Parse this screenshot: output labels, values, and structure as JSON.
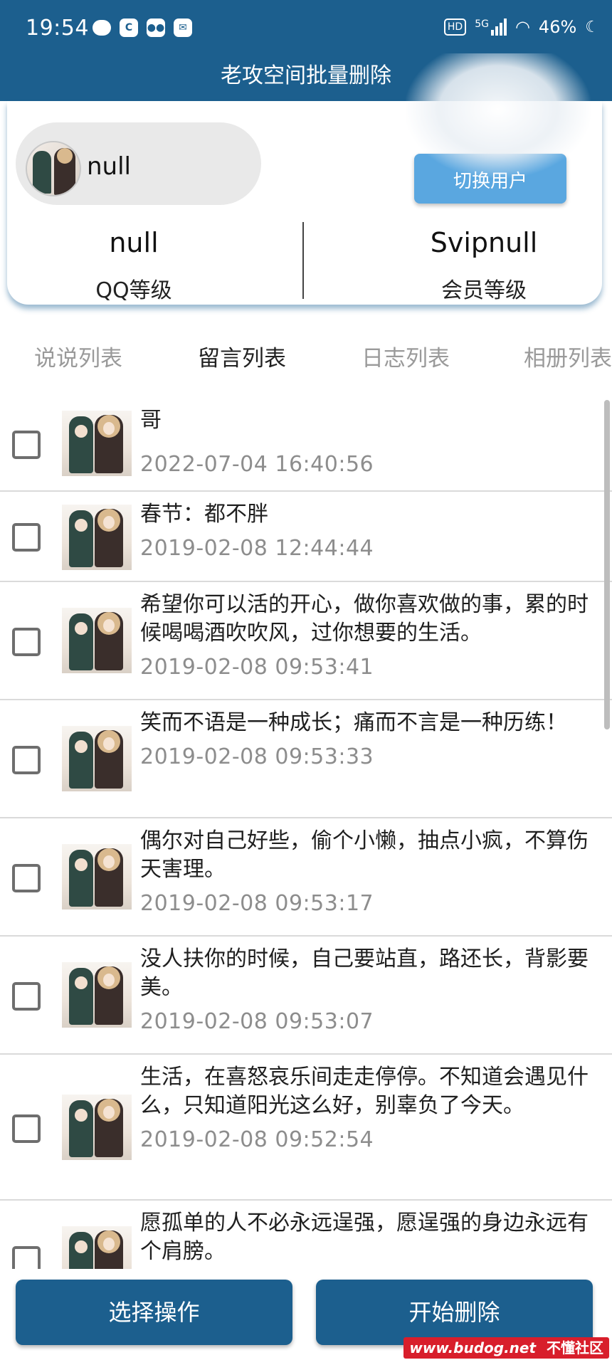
{
  "status_bar": {
    "time": "19:54",
    "network": "5G",
    "hd": "HD",
    "battery": "46%",
    "icons_left": [
      "chat-bubble-icon",
      "qq-browser-icon",
      "cat-icon",
      "mail-icon"
    ]
  },
  "app": {
    "title": "老攻空间批量删除"
  },
  "profile": {
    "nickname": "null",
    "switch_user_label": "切换用户",
    "qq_level_value": "null",
    "qq_level_label": "QQ等级",
    "vip_level_value": "Svipnull",
    "vip_level_label": "会员等级"
  },
  "tabs": [
    {
      "label": "说说列表",
      "active": false
    },
    {
      "label": "留言列表",
      "active": true
    },
    {
      "label": "日志列表",
      "active": false
    },
    {
      "label": "相册列表",
      "active": false
    }
  ],
  "messages": [
    {
      "text": "哥",
      "time": "2022-07-04 16:40:56"
    },
    {
      "text": "春节：都不胖",
      "time": "2019-02-08 12:44:44"
    },
    {
      "text": "希望你可以活的开心，做你喜欢做的事，累的时候喝喝酒吹吹风，过你想要的生活。",
      "time": "2019-02-08 09:53:41"
    },
    {
      "text": "笑而不语是一种成长；痛而不言是一种历练！",
      "time": "2019-02-08 09:53:33"
    },
    {
      "text": "偶尔对自己好些，偷个小懒，抽点小疯，不算伤天害理。",
      "time": "2019-02-08 09:53:17"
    },
    {
      "text": "没人扶你的时候，自己要站直，路还长，背影要美。",
      "time": "2019-02-08 09:53:07"
    },
    {
      "text": "生活，在喜怒哀乐间走走停停。不知道会遇见什么，只知道阳光这么好，别辜负了今天。",
      "time": "2019-02-08 09:52:54"
    },
    {
      "text": "愿孤单的人不必永远逞强，愿逞强的身边永远有个肩膀。",
      "time": ""
    }
  ],
  "actions": {
    "select_label": "选择操作",
    "delete_label": "开始删除"
  },
  "watermark": {
    "site": "www.budog.net",
    "name": "不懂社区"
  },
  "colors": {
    "primary": "#1c5f8e",
    "switch_button": "#5aa7e0",
    "watermark": "#d81e2b"
  }
}
